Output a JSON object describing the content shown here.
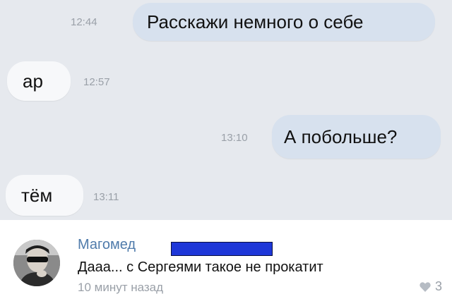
{
  "messages": [
    {
      "text": "Расскажи немного о себе",
      "time": "12:44",
      "direction": "outgoing"
    },
    {
      "text": "ар",
      "time": "12:57",
      "direction": "incoming"
    },
    {
      "text": "А побольше?",
      "time": "13:10",
      "direction": "outgoing"
    },
    {
      "text": "тём",
      "time": "13:11",
      "direction": "incoming"
    }
  ],
  "comment": {
    "author": "Магомед",
    "author_redacted": true,
    "text": "Дааа... с Сергеями такое не прокатит",
    "time": "10 минут назад",
    "likes": "3",
    "like_icon": "heart-icon",
    "avatar": "user-avatar-photo"
  },
  "colors": {
    "chat_background": "#e6e9ee",
    "outgoing_bubble": "#d7e1ee",
    "incoming_bubble": "#f7f8fa",
    "author_name": "#4f7bab",
    "redaction": "#1e37d8",
    "meta_text": "#9aa0a8"
  }
}
